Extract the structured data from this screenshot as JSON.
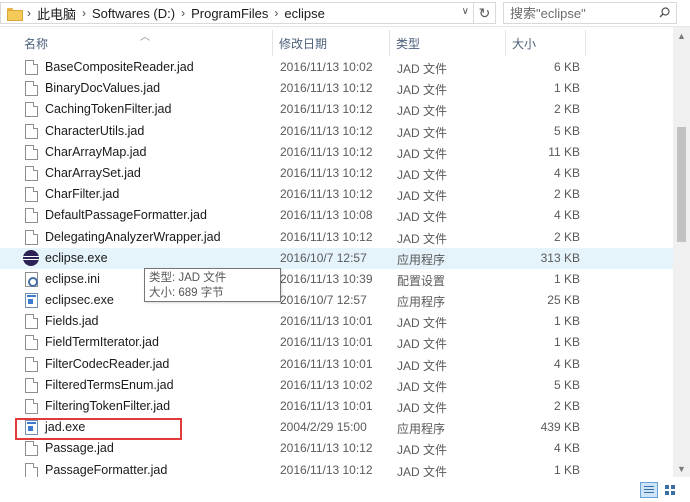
{
  "address": {
    "crumbs": [
      "此电脑",
      "Softwares (D:)",
      "ProgramFiles",
      "eclipse"
    ],
    "search_placeholder": "搜索\"eclipse\""
  },
  "columns": {
    "name": "名称",
    "date": "修改日期",
    "type": "类型",
    "size": "大小"
  },
  "files": [
    {
      "name": "BaseCompositeReader.jad",
      "date": "2016/11/13 10:02",
      "type": "JAD 文件",
      "size": "6 KB",
      "icon": "document-icon"
    },
    {
      "name": "BinaryDocValues.jad",
      "date": "2016/11/13 10:12",
      "type": "JAD 文件",
      "size": "1 KB",
      "icon": "document-icon"
    },
    {
      "name": "CachingTokenFilter.jad",
      "date": "2016/11/13 10:12",
      "type": "JAD 文件",
      "size": "2 KB",
      "icon": "document-icon"
    },
    {
      "name": "CharacterUtils.jad",
      "date": "2016/11/13 10:12",
      "type": "JAD 文件",
      "size": "5 KB",
      "icon": "document-icon"
    },
    {
      "name": "CharArrayMap.jad",
      "date": "2016/11/13 10:12",
      "type": "JAD 文件",
      "size": "11 KB",
      "icon": "document-icon"
    },
    {
      "name": "CharArraySet.jad",
      "date": "2016/11/13 10:12",
      "type": "JAD 文件",
      "size": "4 KB",
      "icon": "document-icon"
    },
    {
      "name": "CharFilter.jad",
      "date": "2016/11/13 10:12",
      "type": "JAD 文件",
      "size": "2 KB",
      "icon": "document-icon"
    },
    {
      "name": "DefaultPassageFormatter.jad",
      "date": "2016/11/13 10:08",
      "type": "JAD 文件",
      "size": "4 KB",
      "icon": "document-icon"
    },
    {
      "name": "DelegatingAnalyzerWrapper.jad",
      "date": "2016/11/13 10:12",
      "type": "JAD 文件",
      "size": "2 KB",
      "icon": "document-icon"
    },
    {
      "name": "eclipse.exe",
      "date": "2016/10/7 12:57",
      "type": "应用程序",
      "size": "313 KB",
      "icon": "eclipse-icon"
    },
    {
      "name": "eclipse.ini",
      "date": "2016/11/13 10:39",
      "type": "配置设置",
      "size": "1 KB",
      "icon": "settings-file-icon"
    },
    {
      "name": "eclipsec.exe",
      "date": "2016/10/7 12:57",
      "type": "应用程序",
      "size": "25 KB",
      "icon": "application-icon"
    },
    {
      "name": "Fields.jad",
      "date": "2016/11/13 10:01",
      "type": "JAD 文件",
      "size": "1 KB",
      "icon": "document-icon"
    },
    {
      "name": "FieldTermIterator.jad",
      "date": "2016/11/13 10:01",
      "type": "JAD 文件",
      "size": "1 KB",
      "icon": "document-icon"
    },
    {
      "name": "FilterCodecReader.jad",
      "date": "2016/11/13 10:01",
      "type": "JAD 文件",
      "size": "4 KB",
      "icon": "document-icon"
    },
    {
      "name": "FilteredTermsEnum.jad",
      "date": "2016/11/13 10:02",
      "type": "JAD 文件",
      "size": "5 KB",
      "icon": "document-icon"
    },
    {
      "name": "FilteringTokenFilter.jad",
      "date": "2016/11/13 10:01",
      "type": "JAD 文件",
      "size": "2 KB",
      "icon": "document-icon"
    },
    {
      "name": "jad.exe",
      "date": "2004/2/29 15:00",
      "type": "应用程序",
      "size": "439 KB",
      "icon": "application-icon"
    },
    {
      "name": "Passage.jad",
      "date": "2016/11/13 10:12",
      "type": "JAD 文件",
      "size": "4 KB",
      "icon": "document-icon"
    },
    {
      "name": "PassageFormatter.jad",
      "date": "2016/11/13 10:12",
      "type": "JAD 文件",
      "size": "1 KB",
      "icon": "document-icon"
    }
  ],
  "tooltip": {
    "type_line": "类型: JAD 文件",
    "size_line": "大小: 689 字节"
  },
  "colors": {
    "hover_row": "#e5f3fb",
    "highlight_border": "#e23a3a",
    "header_text": "#4c607a"
  }
}
